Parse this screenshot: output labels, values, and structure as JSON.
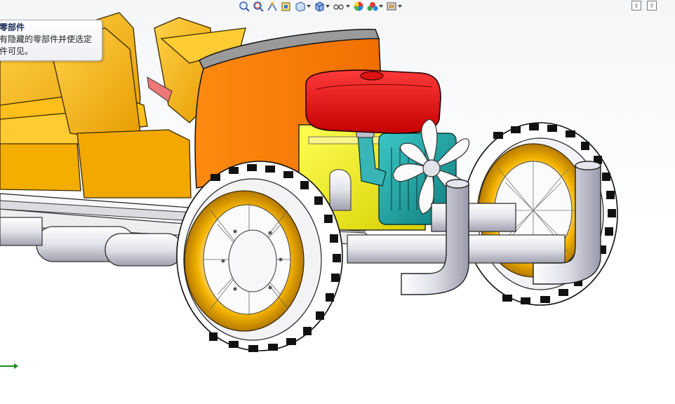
{
  "toolbar": {
    "items": [
      {
        "name": "zoom-to-fit-icon",
        "caret": false
      },
      {
        "name": "zoom-to-area-icon",
        "caret": false
      },
      {
        "name": "previous-view-icon",
        "caret": false
      },
      {
        "name": "section-view-icon",
        "caret": false
      },
      {
        "name": "view-orientation-icon",
        "caret": true
      },
      {
        "name": "display-style-icon",
        "caret": true
      },
      {
        "name": "hide-show-items-icon",
        "caret": true
      },
      {
        "name": "edit-appearance-icon",
        "caret": false
      },
      {
        "name": "apply-scene-icon",
        "caret": true
      },
      {
        "name": "view-settings-icon",
        "caret": true
      }
    ]
  },
  "window_controls": {
    "restore": "▯",
    "split": "▯"
  },
  "tooltip": {
    "title": "零部件",
    "line1": "有隐藏的零部件并使选定",
    "line2": "件可见。"
  },
  "colors": {
    "seat": "#f7b500",
    "fender": "#ff7a00",
    "tank": "#e80a0a",
    "engine_block": "#f2ee00",
    "engine_cover": "#1fa3a3",
    "rim": "#f4b400",
    "tire": "#ffffff",
    "tread": "#111111",
    "frame": "#e8e8ec"
  }
}
